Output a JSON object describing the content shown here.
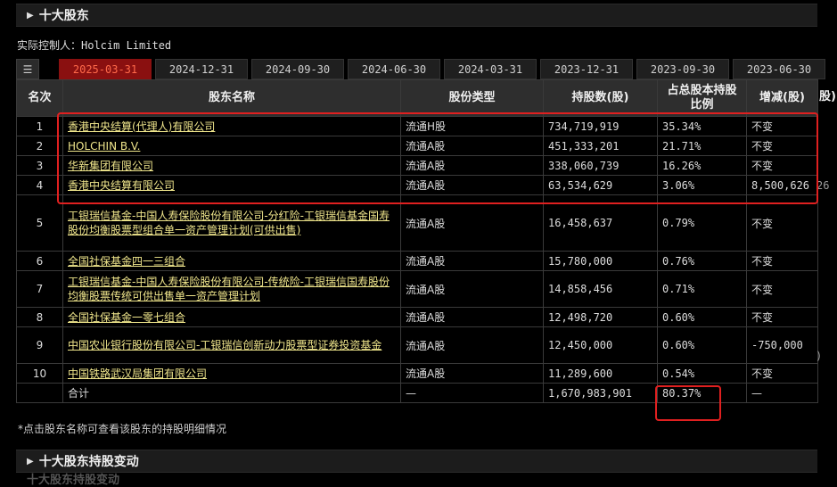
{
  "sections": {
    "top_title": "十大股东",
    "bottom_title": "十大股东持股变动",
    "ghost_bottom": "十大股东持股变动"
  },
  "controller": "实际控制人：Holcim Limited",
  "tabs": [
    "2025-03-31",
    "2024-12-31",
    "2024-09-30",
    "2024-06-30",
    "2024-03-31",
    "2023-12-31",
    "2023-09-30",
    "2023-06-30"
  ],
  "table": {
    "headers": {
      "rank": "名次",
      "name": "股东名称",
      "type": "股份类型",
      "shares": "持股数(股)",
      "ratio": "占总股本持股比例",
      "change": "增减(股)"
    },
    "header_overflow": "股)",
    "rows": [
      {
        "rank": "1",
        "name": "香港中央结算(代理人)有限公司",
        "type": "流通H股",
        "shares": "734,719,919",
        "ratio": "35.34%",
        "change": "不变",
        "change_class": ""
      },
      {
        "rank": "2",
        "name": "HOLCHIN B.V.",
        "type": "流通A股",
        "shares": "451,333,201",
        "ratio": "21.71%",
        "change": "不变",
        "change_class": ""
      },
      {
        "rank": "3",
        "name": "华新集团有限公司",
        "type": "流通A股",
        "shares": "338,060,739",
        "ratio": "16.26%",
        "change": "不变",
        "change_class": ""
      },
      {
        "rank": "4",
        "name": "香港中央结算有限公司",
        "type": "流通A股",
        "shares": "63,534,629",
        "ratio": "3.06%",
        "change": "8,500,626",
        "change_class": "up"
      },
      {
        "rank": "5",
        "name": "工银瑞信基金-中国人寿保险股份有限公司-分红险-工银瑞信基金国寿股份均衡股票型组合单一资产管理计划(可供出售)",
        "type": "流通A股",
        "shares": "16,458,637",
        "ratio": "0.79%",
        "change": "不变",
        "change_class": ""
      },
      {
        "rank": "6",
        "name": "全国社保基金四一三组合",
        "type": "流通A股",
        "shares": "15,780,000",
        "ratio": "0.76%",
        "change": "不变",
        "change_class": ""
      },
      {
        "rank": "7",
        "name": "工银瑞信基金-中国人寿保险股份有限公司-传统险-工银瑞信国寿股份均衡股票传统可供出售单一资产管理计划",
        "type": "流通A股",
        "shares": "14,858,456",
        "ratio": "0.71%",
        "change": "不变",
        "change_class": ""
      },
      {
        "rank": "8",
        "name": "全国社保基金一零七组合",
        "type": "流通A股",
        "shares": "12,498,720",
        "ratio": "0.60%",
        "change": "不变",
        "change_class": ""
      },
      {
        "rank": "9",
        "name": "中国农业银行股份有限公司-工银瑞信创新动力股票型证券投资基金",
        "type": "流通A股",
        "shares": "12,450,000",
        "ratio": "0.60%",
        "change": "-750,000",
        "change_class": "down"
      },
      {
        "rank": "10",
        "name": "中国铁路武汉局集团有限公司",
        "type": "流通A股",
        "shares": "11,289,600",
        "ratio": "0.54%",
        "change": "不变",
        "change_class": ""
      }
    ],
    "total": {
      "label": "合计",
      "type": "—",
      "shares": "1,670,983,901",
      "ratio": "80.37%",
      "change": "—"
    }
  },
  "note": "*点击股东名称可查看该股东的持股明细情况",
  "edge_fragments": {
    "row4": "26",
    "row9": ")"
  },
  "colors": {
    "accent_red": "#e02020",
    "increase": "#ff4d3b",
    "decrease": "#3fcf5a",
    "link": "#f0e68c"
  }
}
